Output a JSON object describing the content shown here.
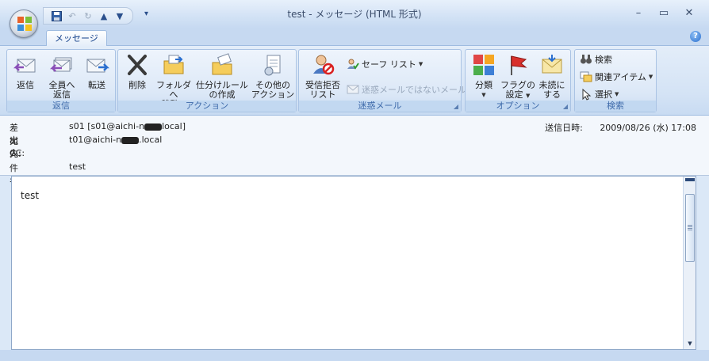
{
  "window": {
    "title": "test - メッセージ (HTML 形式)",
    "controls": {
      "minimize": "–",
      "maximize": "▭",
      "close": "✕"
    }
  },
  "quick_access": {
    "items": [
      "save-icon",
      "undo-icon",
      "redo-icon",
      "previous-item-icon",
      "next-item-icon"
    ],
    "customize": "▾"
  },
  "tabs": {
    "active": "メッセージ",
    "help": "?"
  },
  "ribbon": {
    "groups": {
      "reply": {
        "label": "返信",
        "reply": "返信",
        "reply_all_1": "全員へ",
        "reply_all_2": "返信",
        "forward": "転送"
      },
      "actions": {
        "label": "アクション",
        "delete": "削除",
        "move_1": "フォルダへ",
        "move_2": "移動",
        "rules_1": "仕分けルール",
        "rules_2": "の作成",
        "other_1": "その他の",
        "other_2": "アクション"
      },
      "junk": {
        "label": "迷惑メール",
        "block_1": "受信拒否",
        "block_2": "リスト",
        "safe_list": "セーフ リスト",
        "not_junk": "迷惑メールではないメール"
      },
      "options": {
        "label": "オプション",
        "categorize": "分類",
        "flag_1": "フラグの",
        "flag_2": "設定",
        "unread_1": "未読に",
        "unread_2": "する"
      },
      "find": {
        "label": "検索",
        "find": "検索",
        "related": "関連アイテム",
        "select": "選択"
      }
    }
  },
  "header": {
    "from_label": "差出人:",
    "from_value_pre": "s01 [s01@aichi-n",
    "from_value_post": "local]",
    "to_label": "宛先:",
    "to_value_pre": "t01@aichi-n",
    "to_value_post": ".local",
    "cc_label": "CC:",
    "subject_label": "件名:",
    "subject_value": "test",
    "sent_label": "送信日時:",
    "sent_value": "2009/08/26 (水) 17:08"
  },
  "body": {
    "text": "test"
  },
  "colors": {
    "ribbon_label": "#3e6aaa",
    "title_text": "#3b4d6b",
    "accent": "#15428b"
  }
}
